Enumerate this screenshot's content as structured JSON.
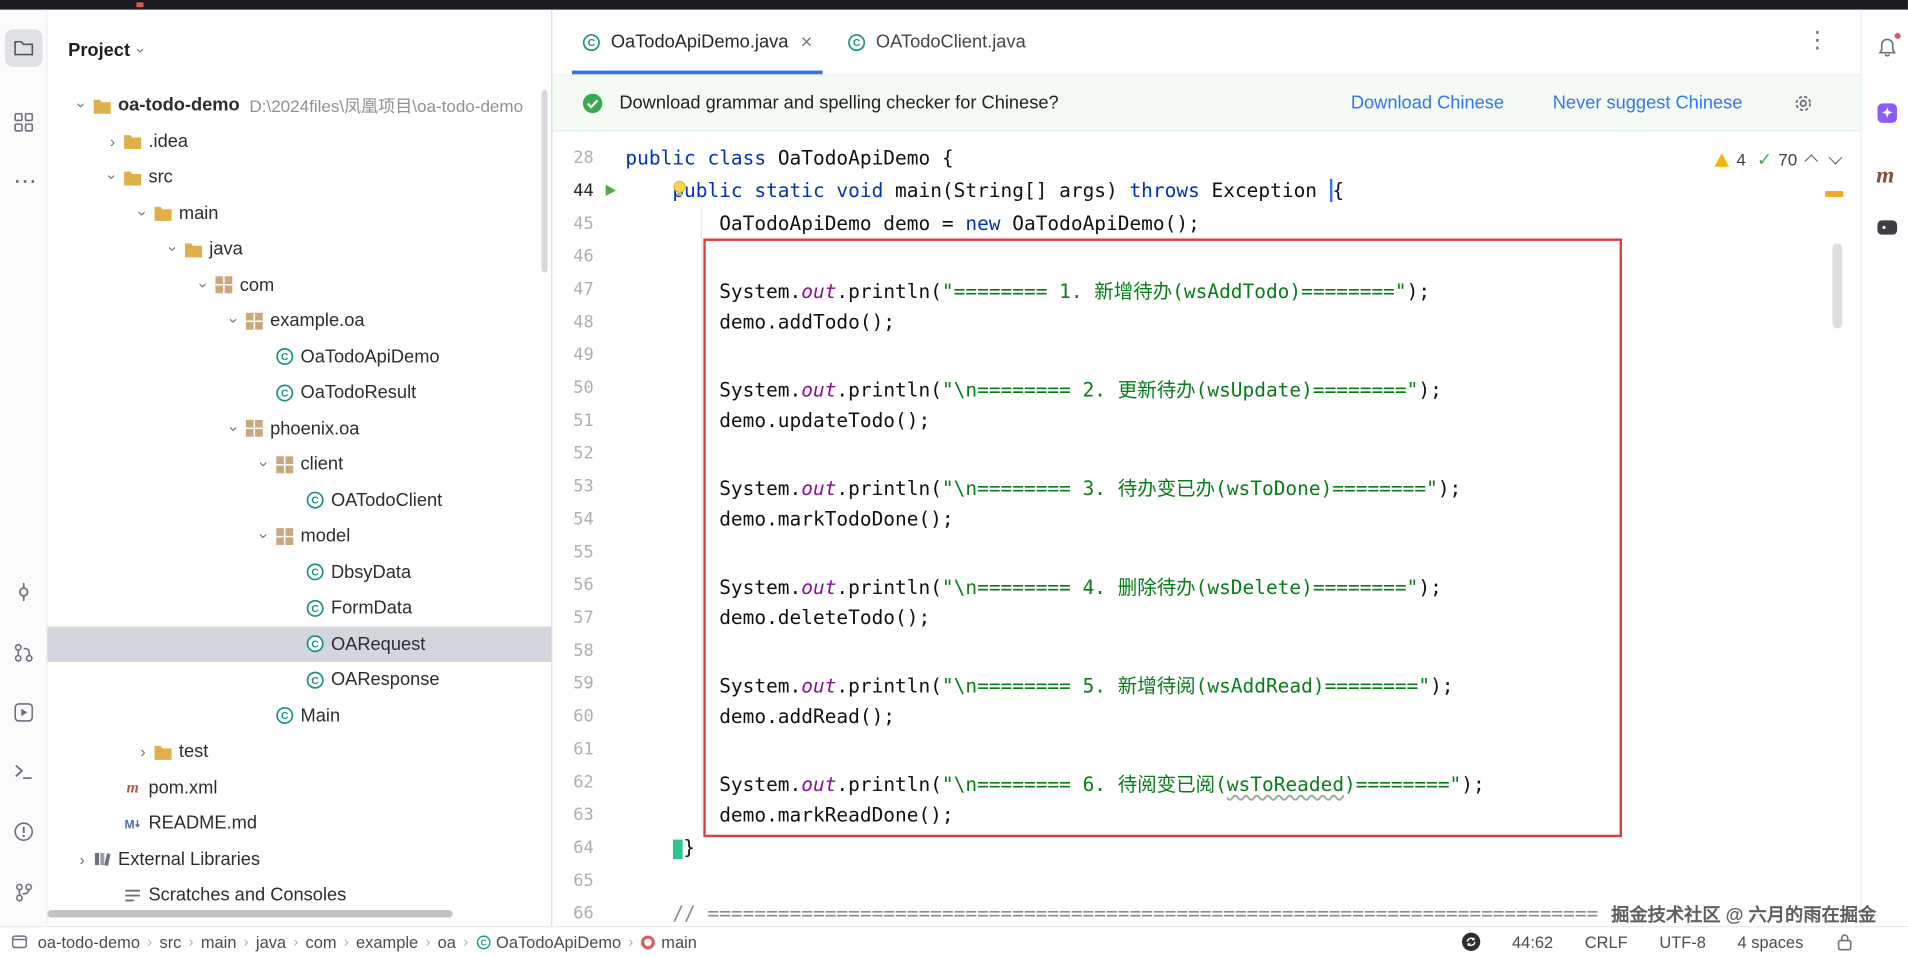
{
  "window": {
    "app": "IntelliJ IDEA",
    "theme": "light"
  },
  "colors": {
    "accent": "#3574F0",
    "keyword": "#0033B3",
    "string": "#067D17",
    "field": "#871094",
    "comment": "#8C8C8C",
    "banner_bg": "#F3FBF3",
    "annotation_red": "#E03E3E",
    "tree_selection": "#D3D6DC",
    "run_green": "#57A64A",
    "warning_yellow": "#F2B501",
    "ok_green": "#4FA658"
  },
  "left_toolbar": {
    "items": [
      {
        "name": "project",
        "selected": true
      },
      {
        "name": "structure"
      },
      {
        "name": "more"
      },
      {
        "name": "commit"
      },
      {
        "name": "pull-requests"
      },
      {
        "name": "services"
      },
      {
        "name": "terminal"
      },
      {
        "name": "problems"
      },
      {
        "name": "version-control"
      }
    ]
  },
  "right_toolbar": {
    "items": [
      {
        "name": "notifications",
        "badge": true
      },
      {
        "name": "ai-assistant"
      },
      {
        "name": "maven-tool"
      },
      {
        "name": "gradle"
      }
    ]
  },
  "project_panel": {
    "title": "Project",
    "tree": [
      {
        "label": "oa-todo-demo",
        "suffix": "D:\\2024files\\凤凰项目\\oa-todo-demo",
        "icon": "folder",
        "indent": 0,
        "chevron": "expanded",
        "bold": true
      },
      {
        "label": ".idea",
        "icon": "folder",
        "indent": 1,
        "chevron": "collapsed"
      },
      {
        "label": "src",
        "icon": "folder",
        "indent": 1,
        "chevron": "expanded"
      },
      {
        "label": "main",
        "icon": "folder",
        "indent": 2,
        "chevron": "expanded"
      },
      {
        "label": "java",
        "icon": "folder",
        "indent": 3,
        "chevron": "expanded"
      },
      {
        "label": "com",
        "icon": "package",
        "indent": 4,
        "chevron": "expanded"
      },
      {
        "label": "example.oa",
        "icon": "package",
        "indent": 5,
        "chevron": "expanded"
      },
      {
        "label": "OaTodoApiDemo",
        "icon": "class",
        "indent": 6
      },
      {
        "label": "OaTodoResult",
        "icon": "class",
        "indent": 6
      },
      {
        "label": "phoenix.oa",
        "icon": "package",
        "indent": 5,
        "chevron": "expanded"
      },
      {
        "label": "client",
        "icon": "package",
        "indent": 6,
        "chevron": "expanded"
      },
      {
        "label": "OATodoClient",
        "icon": "class",
        "indent": 7
      },
      {
        "label": "model",
        "icon": "package",
        "indent": 6,
        "chevron": "expanded"
      },
      {
        "label": "DbsyData",
        "icon": "class",
        "indent": 7
      },
      {
        "label": "FormData",
        "icon": "class",
        "indent": 7
      },
      {
        "label": "OARequest",
        "icon": "class",
        "indent": 7,
        "selected": true
      },
      {
        "label": "OAResponse",
        "icon": "class",
        "indent": 7
      },
      {
        "label": "Main",
        "icon": "class",
        "indent": 6
      },
      {
        "label": "test",
        "icon": "folder",
        "indent": 2,
        "chevron": "collapsed"
      },
      {
        "label": "pom.xml",
        "icon": "maven",
        "indent": 1
      },
      {
        "label": "README.md",
        "icon": "markdown",
        "indent": 1
      },
      {
        "label": "External Libraries",
        "icon": "library",
        "indent": 0,
        "chevron": "collapsed"
      },
      {
        "label": "Scratches and Consoles",
        "icon": "scratch",
        "indent": 1
      }
    ]
  },
  "editor": {
    "tabs": [
      {
        "label": "OaTodoApiDemo.java",
        "icon": "class",
        "active": true,
        "close": "×"
      },
      {
        "label": "OATodoClient.java",
        "icon": "class",
        "active": false
      }
    ],
    "tabs_menu": "⋮",
    "banner": {
      "text": "Download grammar and spelling checker for Chinese?",
      "actions": [
        {
          "label": "Download Chinese"
        },
        {
          "label": "Never suggest Chinese"
        }
      ]
    },
    "inspections": {
      "warnings": "4",
      "passed": "70"
    },
    "code": {
      "lines": [
        {
          "num": "28",
          "tokens": [
            [
              "kw",
              "public class "
            ],
            [
              "pl",
              "OaTodoApiDemo {"
            ]
          ]
        },
        {
          "num": "44",
          "active": true,
          "run": true,
          "bulb": true,
          "tokens": [
            [
              "pl",
              "    "
            ],
            [
              "kw",
              "public static void "
            ],
            [
              "pl",
              "main(String[] args) "
            ],
            [
              "kw",
              "throws "
            ],
            [
              "pl",
              "Exception "
            ],
            [
              "caret",
              ""
            ],
            [
              "pl",
              "{"
            ]
          ]
        },
        {
          "num": "45",
          "tokens": [
            [
              "pl",
              "        OaTodoApiDemo demo = "
            ],
            [
              "kw",
              "new"
            ],
            [
              "pl",
              " OaTodoApiDemo();"
            ]
          ]
        },
        {
          "num": "46",
          "tokens": []
        },
        {
          "num": "47",
          "tokens": [
            [
              "pl",
              "        System."
            ],
            [
              "fld",
              "out"
            ],
            [
              "pl",
              ".println("
            ],
            [
              "str",
              "\"======== 1. 新增待办(wsAddTodo)========\""
            ],
            [
              "pl",
              ");"
            ]
          ]
        },
        {
          "num": "48",
          "tokens": [
            [
              "pl",
              "        demo.addTodo();"
            ]
          ]
        },
        {
          "num": "49",
          "tokens": []
        },
        {
          "num": "50",
          "tokens": [
            [
              "pl",
              "        System."
            ],
            [
              "fld",
              "out"
            ],
            [
              "pl",
              ".println("
            ],
            [
              "str",
              "\"\\n======== 2. 更新待办(wsUpdate)========\""
            ],
            [
              "pl",
              ");"
            ]
          ]
        },
        {
          "num": "51",
          "tokens": [
            [
              "pl",
              "        demo.updateTodo();"
            ]
          ]
        },
        {
          "num": "52",
          "tokens": []
        },
        {
          "num": "53",
          "tokens": [
            [
              "pl",
              "        System."
            ],
            [
              "fld",
              "out"
            ],
            [
              "pl",
              ".println("
            ],
            [
              "str",
              "\"\\n======== 3. 待办变已办(wsToDone)========\""
            ],
            [
              "pl",
              ");"
            ]
          ]
        },
        {
          "num": "54",
          "tokens": [
            [
              "pl",
              "        demo.markTodoDone();"
            ]
          ]
        },
        {
          "num": "55",
          "tokens": []
        },
        {
          "num": "56",
          "tokens": [
            [
              "pl",
              "        System."
            ],
            [
              "fld",
              "out"
            ],
            [
              "pl",
              ".println("
            ],
            [
              "str",
              "\"\\n======== 4. 删除待办(wsDelete)========\""
            ],
            [
              "pl",
              ");"
            ]
          ]
        },
        {
          "num": "57",
          "tokens": [
            [
              "pl",
              "        demo.deleteTodo();"
            ]
          ]
        },
        {
          "num": "58",
          "tokens": []
        },
        {
          "num": "59",
          "tokens": [
            [
              "pl",
              "        System."
            ],
            [
              "fld",
              "out"
            ],
            [
              "pl",
              ".println("
            ],
            [
              "str",
              "\"\\n======== 5. 新增待阅(wsAddRead)========\""
            ],
            [
              "pl",
              ");"
            ]
          ]
        },
        {
          "num": "60",
          "tokens": [
            [
              "pl",
              "        demo.addRead();"
            ]
          ]
        },
        {
          "num": "61",
          "tokens": []
        },
        {
          "num": "62",
          "tokens": [
            [
              "pl",
              "        System."
            ],
            [
              "fld",
              "out"
            ],
            [
              "pl",
              ".println("
            ],
            [
              "str",
              "\"\\n======== 6. 待阅变已阅("
            ],
            [
              "strw",
              "wsToReaded"
            ],
            [
              "str",
              ")========\""
            ],
            [
              "pl",
              ");"
            ]
          ]
        },
        {
          "num": "63",
          "tokens": [
            [
              "pl",
              "        demo.markReadDone();"
            ]
          ]
        },
        {
          "num": "64",
          "tokens": [
            [
              "pl",
              "    "
            ],
            [
              "sel",
              ""
            ],
            [
              "pl",
              "}"
            ]
          ]
        },
        {
          "num": "65",
          "tokens": []
        },
        {
          "num": "66",
          "tokens": [
            [
              "cmt",
              "    // ============================================================================"
            ]
          ]
        }
      ]
    }
  },
  "status_bar": {
    "breadcrumbs": [
      {
        "label": "oa-todo-demo"
      },
      {
        "label": "src"
      },
      {
        "label": "main"
      },
      {
        "label": "java"
      },
      {
        "label": "com"
      },
      {
        "label": "example"
      },
      {
        "label": "oa"
      },
      {
        "label": "OaTodoApiDemo",
        "icon": "class"
      },
      {
        "label": "main",
        "icon": "run-config"
      }
    ],
    "position": "44:62",
    "line_sep": "CRLF",
    "encoding": "UTF-8",
    "indent": "4 spaces"
  },
  "watermark": {
    "text": "掘金技术社区 @ 六月的雨在掘金"
  }
}
